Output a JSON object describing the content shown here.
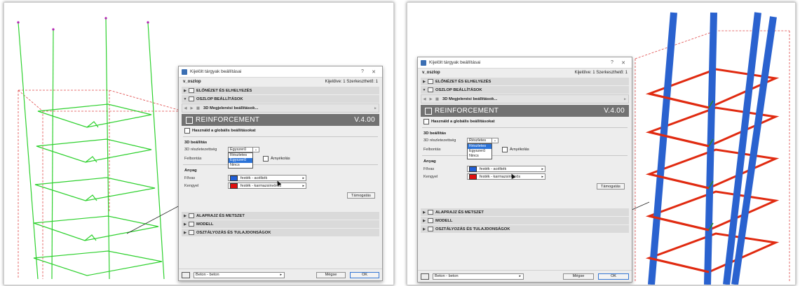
{
  "dialog": {
    "title": "Kijelölt tárgyak beállításai",
    "help_btn": "?",
    "close_btn": "✕",
    "object_name": "v_oszlop",
    "selection_info": "Kijelölve: 1 Szerkeszthető: 1",
    "sections": {
      "preview": "ELŐNÉZET ÉS ELHELYEZÉS",
      "column_settings": "OSZLOP BEÁLLÍTÁSOK",
      "floorplan": "ALAPRAJZ ÉS METSZET",
      "model": "MODELL",
      "classification": "OSZTÁLYOZÁS ÉS TULAJDONSÁGOK"
    },
    "nav_label": "3D Megjelenési beállítások...",
    "banner_title": "REINFORCEMENT",
    "banner_version": "V.4.00",
    "global_settings_label": "Használd a globális beállításokat",
    "group_3d": "3D beállítás",
    "detail_label": "3D részletezettség",
    "resolution_label": "Felbontás",
    "shading_label": "Árnyékolás",
    "material_group": "Anyag",
    "main_bar_label": "Fővas",
    "stirrup_label": "Kengyel",
    "main_bar_material": "festék - acélkék",
    "stirrup_material": "festék - karmazsinvörös",
    "support_btn": "Támogatás",
    "layer_label": "Beton - beton",
    "cancel_btn": "Mégse",
    "ok_btn": "OK"
  },
  "left_view": {
    "detail_selected": "Egyszerű",
    "options": [
      "Részletes",
      "Egyszerű",
      "Nincs"
    ],
    "active_option_index": 1
  },
  "right_view": {
    "detail_selected": "Részletes",
    "options": [
      "Részletes",
      "Egyszerű",
      "Nincs"
    ],
    "active_option_index": 0
  },
  "colors": {
    "main_bar_swatch": "#2160d8",
    "stirrup_swatch": "#e01010",
    "left_rebar": "#2fd12f",
    "right_main_bar": "#2a62cf",
    "right_stirrup": "#e02a10"
  }
}
